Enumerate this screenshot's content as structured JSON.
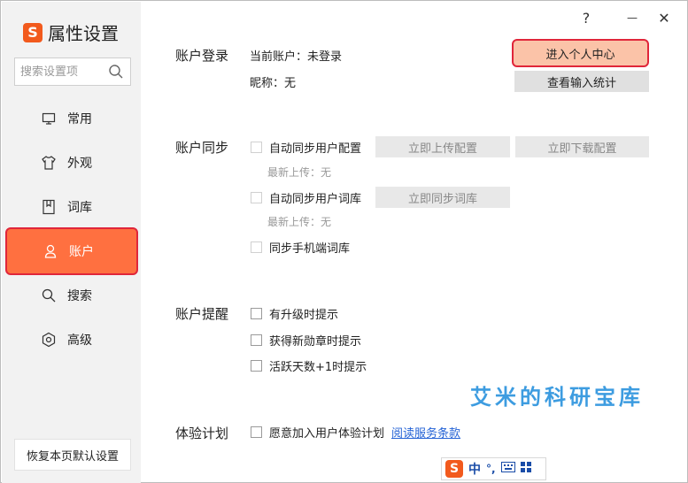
{
  "app": {
    "title": "属性设置",
    "logo_text": "S"
  },
  "window_controls": {
    "help": "?",
    "minimize": "—",
    "close": "✕"
  },
  "search": {
    "placeholder": "搜索设置项"
  },
  "sidebar": {
    "items": [
      {
        "label": "常用",
        "icon": "monitor-icon",
        "active": false
      },
      {
        "label": "外观",
        "icon": "tshirt-icon",
        "active": false
      },
      {
        "label": "词库",
        "icon": "book-icon",
        "active": false
      },
      {
        "label": "账户",
        "icon": "user-icon",
        "active": true
      },
      {
        "label": "搜索",
        "icon": "search-icon",
        "active": false
      },
      {
        "label": "高级",
        "icon": "gear-icon",
        "active": false
      }
    ],
    "reset_label": "恢复本页默认设置"
  },
  "account_login": {
    "title": "账户登录",
    "current_account": "当前账户：未登录",
    "nickname": "昵称：无",
    "enter_center_label": "进入个人中心",
    "view_stats_label": "查看输入统计"
  },
  "account_sync": {
    "title": "账户同步",
    "auto_sync_config": "自动同步用户配置",
    "upload_config_label": "立即上传配置",
    "download_config_label": "立即下载配置",
    "config_last_upload": "最新上传：无",
    "auto_sync_dict": "自动同步用户词库",
    "sync_dict_label": "立即同步词库",
    "dict_last_upload": "最新上传：无",
    "sync_mobile_dict": "同步手机端词库"
  },
  "account_reminder": {
    "title": "账户提醒",
    "upgrade_hint": "有升级时提示",
    "medal_hint": "获得新勋章时提示",
    "active_days_hint": "活跃天数+1时提示"
  },
  "experience_plan": {
    "title": "体验计划",
    "join_label": "愿意加入用户体验计划",
    "terms_link": "阅读服务条款"
  },
  "watermark": "艾米的科研宝库",
  "ime_bar": {
    "logo": "S",
    "mode": "中",
    "punct": "°,"
  },
  "colors": {
    "accent": "#ff7040",
    "highlight_border": "#e0263a",
    "link": "#2563d6",
    "watermark": "#3d9ce0"
  }
}
